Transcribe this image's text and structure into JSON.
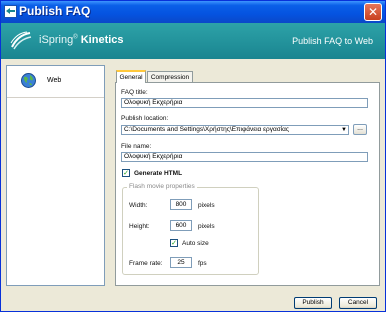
{
  "window": {
    "title": "Publish FAQ"
  },
  "banner": {
    "brand_prefix": "iSpring",
    "brand_reg": "®",
    "brand_name": "Kinetics",
    "right_title": "Publish FAQ to Web"
  },
  "sidebar": {
    "items": [
      {
        "label": "Web",
        "icon": "globe-icon"
      }
    ]
  },
  "tabs": [
    {
      "label": "General"
    },
    {
      "label": "Compression"
    }
  ],
  "general": {
    "faq_title_label": "FAQ title:",
    "faq_title_value": "Ολοφυκή Εκχερήρια",
    "publish_location_label": "Publish location:",
    "publish_location_value": "C:\\Documents and Settings\\Χρήστης\\Επιφάνεια εργασίας",
    "browse_label": "...",
    "file_name_label": "File name:",
    "file_name_value": "Ολοφυκή Εκχερήρια",
    "generate_html_label": "Generate HTML",
    "generate_html_checked": true
  },
  "flash": {
    "group_title": "Flash movie properties",
    "width_label": "Width:",
    "width_value": "800",
    "width_unit": "pixels",
    "height_label": "Height:",
    "height_value": "600",
    "height_unit": "pixels",
    "auto_size_label": "Auto size",
    "auto_size_checked": true,
    "frame_rate_label": "Frame rate:",
    "frame_rate_value": "25",
    "frame_rate_unit": "fps"
  },
  "buttons": {
    "publish": "Publish",
    "cancel": "Cancel"
  },
  "colors": {
    "titlebar": "#0553e0",
    "banner": "#1a8590",
    "close": "#c8401e"
  }
}
